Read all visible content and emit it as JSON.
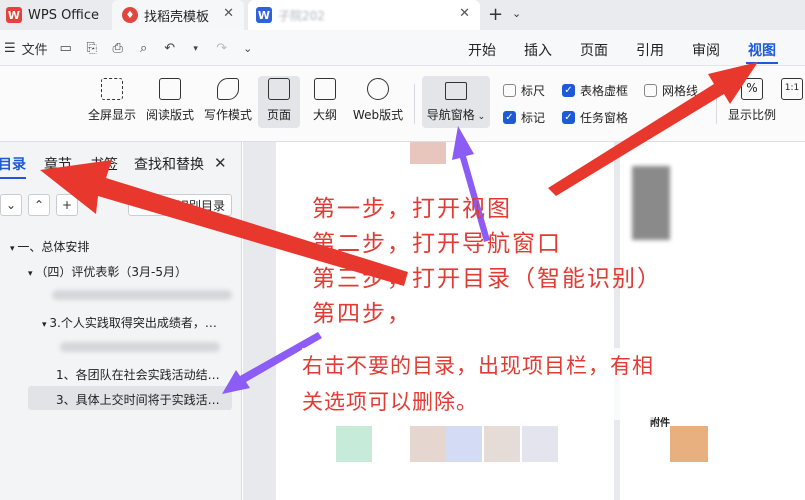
{
  "tabs": {
    "wps": "WPS Office",
    "template": "找稻壳模板",
    "doc_title_partial": "子院202"
  },
  "menubar": {
    "file": "文件",
    "tabs": [
      "开始",
      "插入",
      "页面",
      "引用",
      "审阅",
      "视图"
    ],
    "active": "视图"
  },
  "ribbon": {
    "fullscreen": "全屏显示",
    "read_mode": "阅读版式",
    "write_mode": "写作模式",
    "page": "页面",
    "outline": "大纲",
    "web": "Web版式",
    "nav_pane": "导航窗格",
    "ruler": "标尺",
    "table_grid": "表格虚框",
    "gridlines": "网格线",
    "marks": "标记",
    "task_pane": "任务窗格",
    "zoom": "显示比例",
    "one_to_one": "1:1"
  },
  "navpane": {
    "tabs": [
      "目录",
      "章节",
      "书签",
      "查找和替换"
    ],
    "smart_btn": "智能识别目录",
    "toc": [
      "一、总体安排",
      "（四）评优表彰（3月-5月）",
      "3.个人实践取得突出成绩者，…",
      "1、各团队在社会实践活动结…",
      "3、具体上交时间将于实践活…"
    ]
  },
  "annotation": {
    "steps": [
      "第一步，打开视图",
      "第二步，打开导航窗口",
      "第三步，打开目录（智能识别）",
      "第四步，"
    ],
    "note": [
      "右击不要的目录，出现项目栏，有相",
      "关选项可以删除。"
    ]
  },
  "page2": {
    "label": "附件"
  },
  "colors": {
    "accent": "#1e59d6",
    "annotation": "#e23b34",
    "arrow_red": "#e8382e",
    "arrow_purple": "#8b5cf6"
  }
}
